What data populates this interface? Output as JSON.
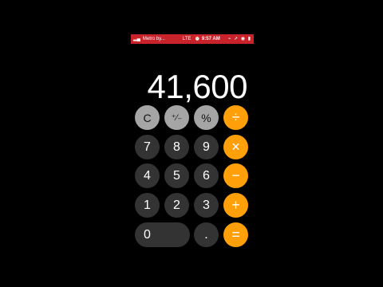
{
  "status_bar": {
    "signal_icon": "signal-bars-icon",
    "carrier": "Metro by...",
    "network": "LTE",
    "alarm_icon": "alarm-icon",
    "time": "9:57 AM",
    "right_icons": "⌁ ➚ ◉ ▮"
  },
  "display": {
    "value": "41,600"
  },
  "buttons": {
    "clear": "C",
    "plus_minus": "⁺⁄₋",
    "percent": "%",
    "divide": "÷",
    "seven": "7",
    "eight": "8",
    "nine": "9",
    "multiply": "×",
    "four": "4",
    "five": "5",
    "six": "6",
    "minus": "−",
    "one": "1",
    "two": "2",
    "three": "3",
    "plus": "+",
    "zero": "0",
    "decimal": ".",
    "equals": "="
  },
  "colors": {
    "status_bar": "#c8222b",
    "function_key": "#a5a5a5",
    "digit_key": "#333333",
    "operator_key": "#ff9f0a"
  }
}
